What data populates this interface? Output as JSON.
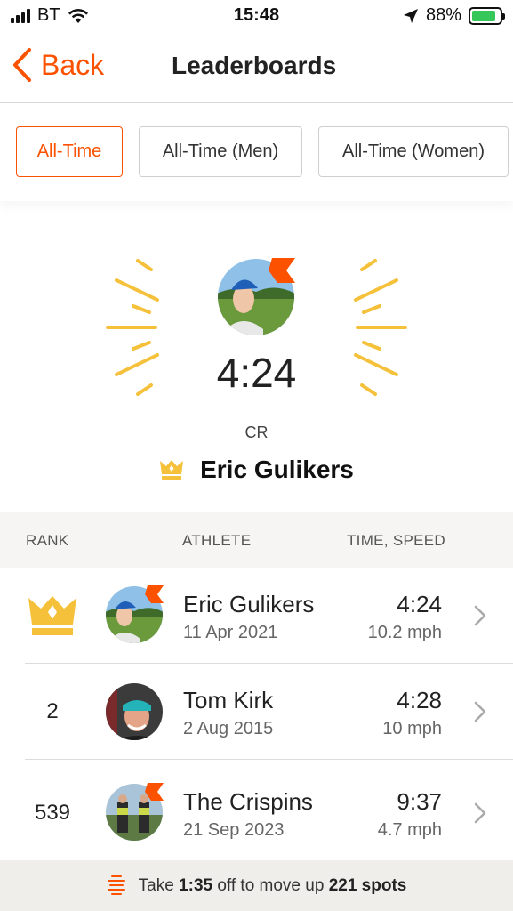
{
  "status_bar": {
    "carrier": "BT",
    "time": "15:48",
    "battery_percent": "88%",
    "icons": [
      "signal-icon",
      "wifi-icon",
      "location-arrow-icon",
      "battery-charging-icon"
    ]
  },
  "nav": {
    "back_label": "Back",
    "title": "Leaderboards"
  },
  "filters": {
    "tabs": [
      {
        "label": "All-Time",
        "active": true
      },
      {
        "label": "All-Time (Men)",
        "active": false
      },
      {
        "label": "All-Time (Women)",
        "active": false
      }
    ]
  },
  "hero": {
    "time": "4:24",
    "badge": "CR",
    "name": "Eric Gulikers"
  },
  "table": {
    "headers": {
      "rank": "RANK",
      "athlete": "ATHLETE",
      "time_speed": "TIME, SPEED"
    },
    "rows": [
      {
        "rank": "",
        "rank_icon": "crown-icon",
        "name": "Eric Gulikers",
        "date": "11 Apr 2021",
        "time": "4:24",
        "speed": "10.2 mph",
        "subscriber": true
      },
      {
        "rank": "2",
        "name": "Tom Kirk",
        "date": "2 Aug 2015",
        "time": "4:28",
        "speed": "10 mph",
        "subscriber": false
      },
      {
        "rank": "539",
        "name": "The Crispins",
        "date": "21 Sep 2023",
        "time": "9:37",
        "speed": "4.7 mph",
        "subscriber": true
      }
    ]
  },
  "footer": {
    "prefix": "Take ",
    "time_off": "1:35",
    "middle": " off to move up ",
    "spots": "221 spots"
  },
  "colors": {
    "accent": "#fc5200",
    "gold": "#f5c13b",
    "battery": "#35c759"
  }
}
